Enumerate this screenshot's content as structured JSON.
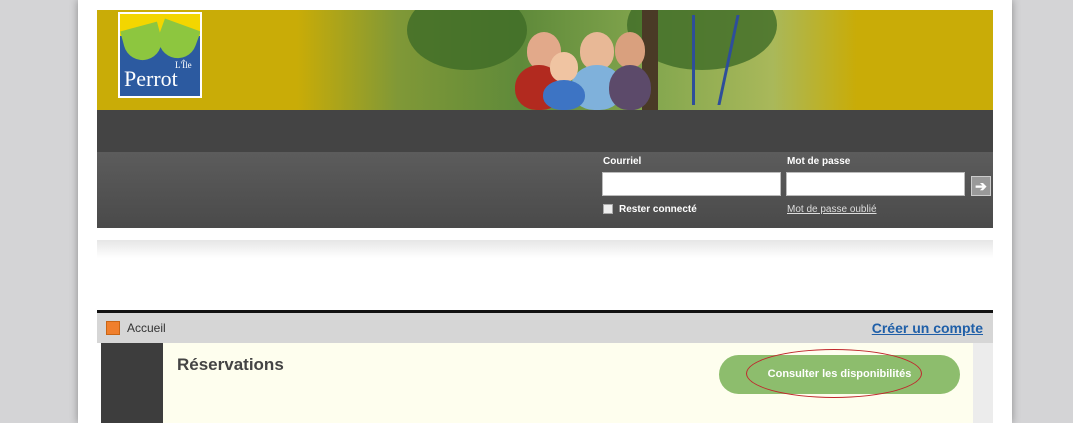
{
  "logo": {
    "name": "Perrot",
    "prefix": "L'Île"
  },
  "login": {
    "email_label": "Courriel",
    "email_value": "",
    "password_label": "Mot de passe",
    "password_value": "",
    "submit_glyph": "➔",
    "remember_label": "Rester connecté",
    "forgot_label": "Mot de passe oublié"
  },
  "breadcrumb": {
    "home_label": "Accueil",
    "create_account_label": "Créer un compte"
  },
  "main": {
    "title": "Réservations",
    "consult_button_label": "Consulter les disponibilités"
  },
  "colors": {
    "banner": "#c9ac07",
    "accent_green": "#8dbd6d",
    "link_blue": "#1f5fa8",
    "highlight_red": "#c0272d"
  }
}
